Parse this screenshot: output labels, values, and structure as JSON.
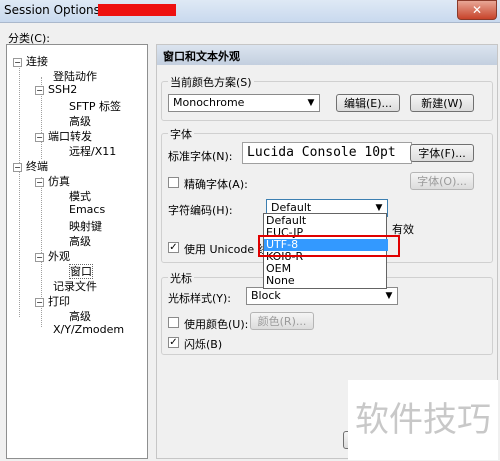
{
  "window": {
    "title": "Session Options -"
  },
  "category": {
    "label": "分类(C):"
  },
  "tree": [
    {
      "label": "连接",
      "expanded": true
    },
    {
      "label": "登陆动作"
    },
    {
      "label": "SSH2",
      "expanded": true
    },
    {
      "label": "SFTP 标签"
    },
    {
      "label": "高级"
    },
    {
      "label": "端口转发",
      "expanded": true
    },
    {
      "label": "远程/X11"
    },
    {
      "label": "终端",
      "expanded": true
    },
    {
      "label": "仿真",
      "expanded": true
    },
    {
      "label": "模式"
    },
    {
      "label": "Emacs"
    },
    {
      "label": "映射键"
    },
    {
      "label": "高级"
    },
    {
      "label": "外观",
      "expanded": true
    },
    {
      "label": "窗口",
      "selected": true
    },
    {
      "label": "记录文件"
    },
    {
      "label": "打印",
      "expanded": true
    },
    {
      "label": "高级"
    },
    {
      "label": "X/Y/Zmodem"
    }
  ],
  "panel": {
    "header": "窗口和文本外观",
    "color_scheme": {
      "group_title": "当前颜色方案(S)",
      "value": "Monochrome",
      "edit_button": "编辑(E)...",
      "new_button": "新建(W)"
    },
    "font": {
      "group_title": "字体",
      "normal_label": "标准字体(N):",
      "normal_value": "Lucida Console 10pt",
      "font_button": "字体(F)...",
      "precise_label": "精确字体(A):",
      "precise_button": "字体(O)...",
      "encoding_label": "字符编码(H):",
      "encoding_value": "Default",
      "encoding_options": [
        "Default",
        "EUC-JP",
        "UTF-8",
        "KOI8-R",
        "OEM",
        "None"
      ],
      "encoding_highlighted": "UTF-8",
      "unicode_label": "使用 Unicode 线条",
      "unicode_suffix": "有效",
      "unicode_checked": true
    },
    "cursor": {
      "group_title": "光标",
      "style_label": "光标样式(Y):",
      "style_value": "Block",
      "use_color_label": "使用颜色(U):",
      "color_button": "颜色(R)...",
      "blink_label": "闪烁(B)",
      "blink_checked": true
    }
  },
  "watermark": "软件技巧",
  "colors": {
    "highlight": "#3399ff",
    "annotation": "#e00000",
    "redaction": "#ee1111"
  }
}
